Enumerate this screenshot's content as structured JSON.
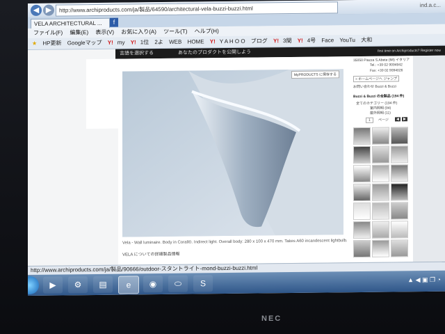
{
  "browser": {
    "url": "http://www.archiproducts.com/ja/製品/64590/architectural-vela-buzzi-buzzi.html",
    "address_right": "ind.a.c...",
    "tab_title": "VELA ARCHITECTURAL ...",
    "new_tab_icon": "f"
  },
  "menu": [
    "ファイル(F)",
    "編集(E)",
    "表示(V)",
    "お気に入り(A)",
    "ツール(T)",
    "ヘルプ(H)"
  ],
  "favorites": [
    "HP更新",
    "Googleマップ",
    "my",
    "1位",
    "2よ",
    "WEB",
    "HOME",
    "Y A H O O",
    "ブログ",
    "3間",
    "4号",
    "Face",
    "YouTu",
    "大和"
  ],
  "page": {
    "blackbar_left": "言語を選択する",
    "blackbar_mid": "あなたのプロダクトを公開しよう",
    "blackbar_right": "first time on Archiproducts? Register now",
    "my_products": "MyPRODUCTS に保存する",
    "caption": "Vela - Wall luminaire. Body in Corall®. Indirect light. Overall body: 280 x 100 x 470 mm. Takes A60 incandescent lightbulb.",
    "caption_link": "VELA についての詳細製品情報",
    "sidebar": {
      "address": "35050 Piazza S.Abete (MI) イタリア",
      "tel": "Tel.: +39 02 9094942",
      "fax": "Fax: +39 02 9094026",
      "homepage": "> ホームページへ ジャンプ",
      "contact": "お問い合わせ Buzzi & Buzzi",
      "products_title": "Buzzi & Buzzi の全製品 (194 件)",
      "cat1": "全てのカテゴリー (194 件)",
      "cat2": "室内照明 (94)",
      "cat3": "屋外照明 (11)",
      "page_label": "1",
      "page_suffix": "ページ"
    }
  },
  "status_url": "http://www.archiproducts.com/ja/製品/90666/outdoor-スタントライト-mond-buzzi-buzzi.html",
  "taskbar": {
    "tray_text": "▲ ◀ ▣ ❐ ◔"
  },
  "bezel_brand": "NEC"
}
